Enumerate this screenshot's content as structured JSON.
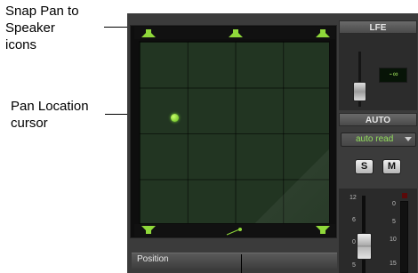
{
  "callouts": {
    "snap": "Snap Pan to Speaker icons",
    "snap_lines": [
      "Snap Pan to",
      "Speaker",
      "icons"
    ],
    "cursor_lines": [
      "Pan Location",
      "cursor"
    ]
  },
  "panner": {
    "position_label": "Position"
  },
  "lfe": {
    "header": "LFE",
    "value": "-∞"
  },
  "auto": {
    "header": "AUTO",
    "mode": "auto read"
  },
  "buttons": {
    "solo": "S",
    "mute": "M"
  },
  "fader_scale": [
    "12",
    "6",
    "0",
    "5"
  ],
  "meter_scale": [
    "0",
    "5",
    "10",
    "15"
  ],
  "colors": {
    "grid": "#223522",
    "speaker": "#8fd83a",
    "cursor": "#7fe03a",
    "display_text": "#9fe25a"
  }
}
